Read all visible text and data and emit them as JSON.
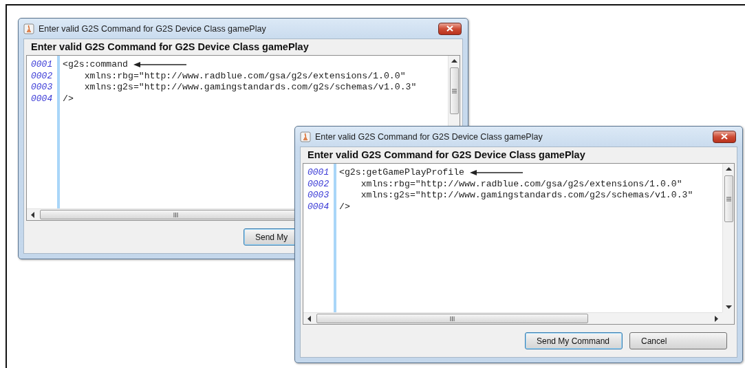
{
  "windows": [
    {
      "title": "Enter valid G2S Command for G2S Device Class gamePlay",
      "heading": "Enter valid G2S Command for G2S Device Class gamePlay",
      "lines": [
        {
          "number": "0001",
          "code": "<g2s:command",
          "arrow": true
        },
        {
          "number": "0002",
          "code": "    xmlns:rbg=\"http://www.radblue.com/gsa/g2s/extensions/1.0.0\"",
          "arrow": false
        },
        {
          "number": "0003",
          "code": "    xmlns:g2s=\"http://www.gamingstandards.com/g2s/schemas/v1.0.3\"",
          "arrow": false
        },
        {
          "number": "0004",
          "code": "/>",
          "arrow": false
        }
      ],
      "buttons": [
        {
          "label": "Send My",
          "default": true
        }
      ]
    },
    {
      "title": "Enter valid G2S Command for G2S Device Class gamePlay",
      "heading": "Enter valid G2S Command for G2S Device Class gamePlay",
      "lines": [
        {
          "number": "0001",
          "code": "<g2s:getGamePlayProfile",
          "arrow": true
        },
        {
          "number": "0002",
          "code": "    xmlns:rbg=\"http://www.radblue.com/gsa/g2s/extensions/1.0.0\"",
          "arrow": false
        },
        {
          "number": "0003",
          "code": "    xmlns:g2s=\"http://www.gamingstandards.com/g2s/schemas/v1.0.3\"",
          "arrow": false
        },
        {
          "number": "0004",
          "code": "/>",
          "arrow": false
        }
      ],
      "buttons": [
        {
          "label": "Send My Command",
          "default": true
        },
        {
          "label": "Cancel",
          "default": false
        }
      ]
    }
  ]
}
